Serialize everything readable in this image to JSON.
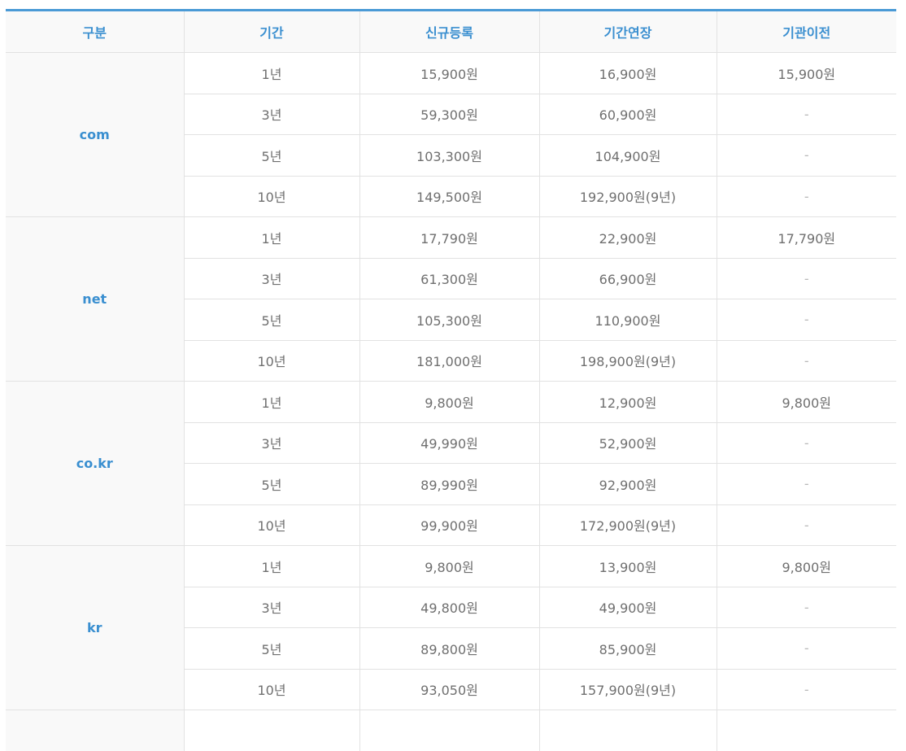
{
  "headers": [
    "구분",
    "기간",
    "신규등록",
    "기간연장",
    "기관이전"
  ],
  "groups": [
    {
      "name": "com",
      "rows": [
        {
          "period": "1년",
          "new": "15,900원",
          "renew": "16,900원",
          "transfer": "15,900원"
        },
        {
          "period": "3년",
          "new": "59,300원",
          "renew": "60,900원",
          "transfer": "-"
        },
        {
          "period": "5년",
          "new": "103,300원",
          "renew": "104,900원",
          "transfer": "-"
        },
        {
          "period": "10년",
          "new": "149,500원",
          "renew": "192,900원(9년)",
          "transfer": "-"
        }
      ]
    },
    {
      "name": "net",
      "rows": [
        {
          "period": "1년",
          "new": "17,790원",
          "renew": "22,900원",
          "transfer": "17,790원"
        },
        {
          "period": "3년",
          "new": "61,300원",
          "renew": "66,900원",
          "transfer": "-"
        },
        {
          "period": "5년",
          "new": "105,300원",
          "renew": "110,900원",
          "transfer": "-"
        },
        {
          "period": "10년",
          "new": "181,000원",
          "renew": "198,900원(9년)",
          "transfer": "-"
        }
      ]
    },
    {
      "name": "co.kr",
      "rows": [
        {
          "period": "1년",
          "new": "9,800원",
          "renew": "12,900원",
          "transfer": "9,800원"
        },
        {
          "period": "3년",
          "new": "49,990원",
          "renew": "52,900원",
          "transfer": "-"
        },
        {
          "period": "5년",
          "new": "89,990원",
          "renew": "92,900원",
          "transfer": "-"
        },
        {
          "period": "10년",
          "new": "99,900원",
          "renew": "172,900원(9년)",
          "transfer": "-"
        }
      ]
    },
    {
      "name": "kr",
      "rows": [
        {
          "period": "1년",
          "new": "9,800원",
          "renew": "13,900원",
          "transfer": "9,800원"
        },
        {
          "period": "3년",
          "new": "49,800원",
          "renew": "49,900원",
          "transfer": "-"
        },
        {
          "period": "5년",
          "new": "89,800원",
          "renew": "85,900원",
          "transfer": "-"
        },
        {
          "period": "10년",
          "new": "93,050원",
          "renew": "157,900원(9년)",
          "transfer": "-"
        }
      ]
    }
  ],
  "colors": {
    "accent": "#3a8fd0",
    "header_bg": "#f9f9f9",
    "border": "#e2e2e2",
    "text": "#6f6f6f"
  }
}
